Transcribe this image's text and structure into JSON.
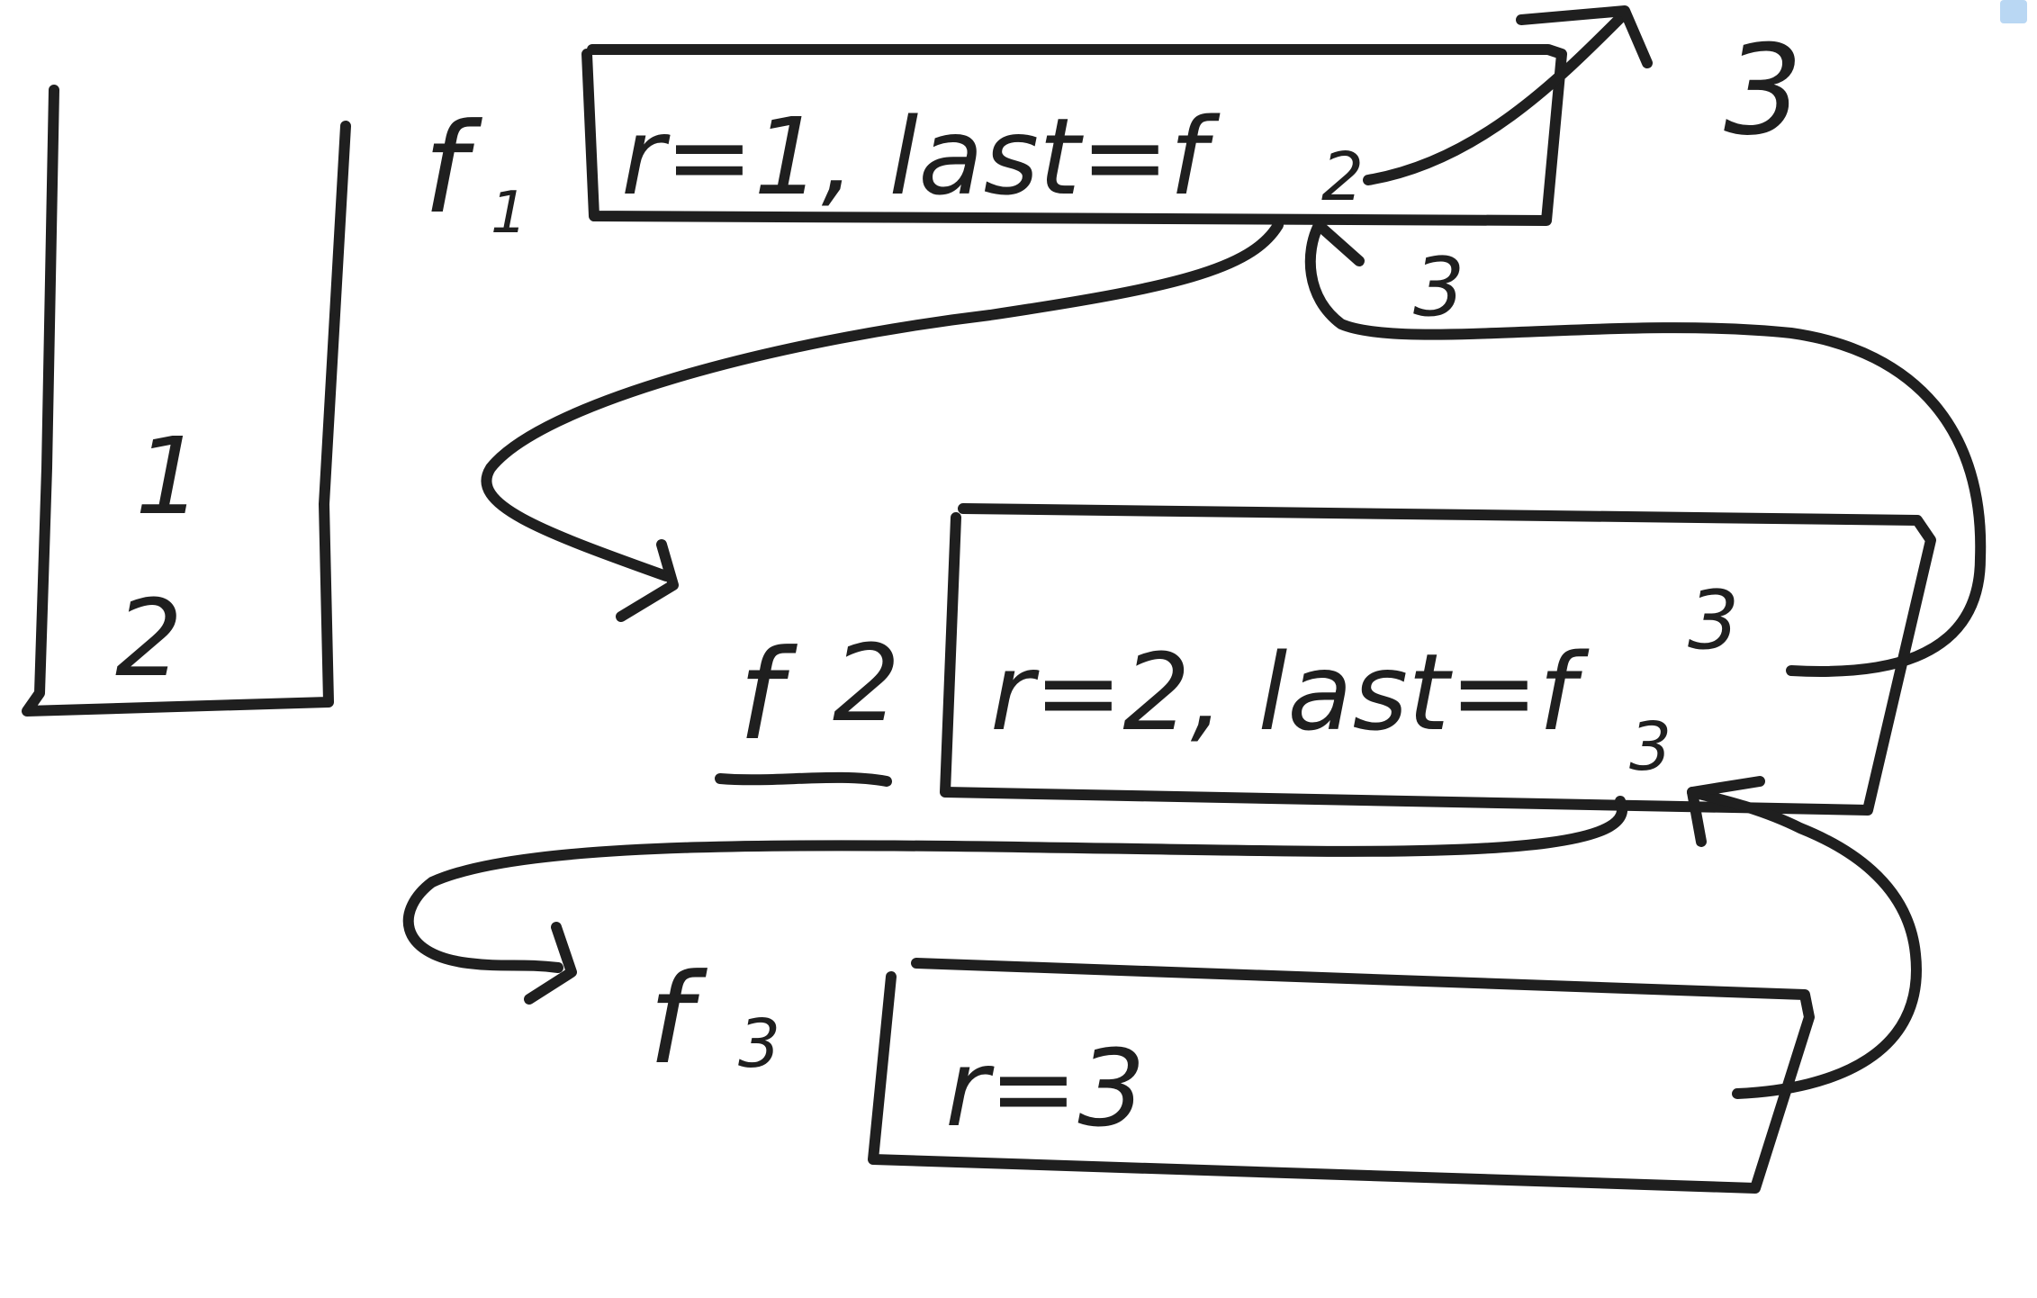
{
  "stack": {
    "items": [
      "1",
      "2"
    ]
  },
  "frames": [
    {
      "name_letter": "f",
      "name_subscript": "1",
      "contents": "r=1, last=f",
      "last_subscript": "2"
    },
    {
      "name_letter": "f",
      "name_subscript": "2",
      "contents": "r=2, last=f",
      "last_subscript": "3"
    },
    {
      "name_letter": "f",
      "name_subscript": "3",
      "contents": "r=3"
    }
  ],
  "return_labels": {
    "final_result": "3",
    "f2_to_f1": "3",
    "f3_to_f2": "3"
  },
  "colors": {
    "ink": "#1f1f1f",
    "background": "#ffffff"
  }
}
